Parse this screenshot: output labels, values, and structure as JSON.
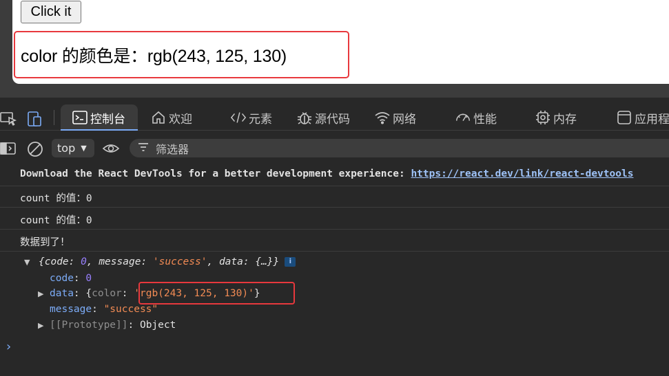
{
  "page": {
    "button_label": "Click it",
    "color_text": "color 的颜色是：rgb(243, 125, 130)"
  },
  "devtools": {
    "tabs": [
      {
        "label": "控制台",
        "icon": "console-icon",
        "active": true
      },
      {
        "label": "欢迎",
        "icon": "home-icon",
        "active": false
      },
      {
        "label": "元素",
        "icon": "elements-icon",
        "active": false
      },
      {
        "label": "源代码",
        "icon": "bug-icon",
        "active": false
      },
      {
        "label": "网络",
        "icon": "wifi-icon",
        "active": false
      },
      {
        "label": "性能",
        "icon": "gauge-icon",
        "active": false
      },
      {
        "label": "内存",
        "icon": "chip-icon",
        "active": false
      },
      {
        "label": "应用程",
        "icon": "app-icon",
        "active": false
      }
    ],
    "toolbar": {
      "context": "top",
      "filter_placeholder": "筛选器"
    }
  },
  "console": {
    "react_msg": "Download the React DevTools for a better development experience: ",
    "react_link": "https://react.dev/link/react-devtools",
    "logs": [
      "count 的值：0",
      "count 的值：0",
      "数据到了！"
    ],
    "object_summary": {
      "open": "{",
      "code_key": "code",
      "code_val": "0",
      "message_key": "message",
      "message_val": "'success'",
      "data_key": "data",
      "data_val": "{…}",
      "close": "}"
    },
    "props": {
      "code_key": "code",
      "code_val": "0",
      "data_key": "data",
      "data_open": "{",
      "color_key": "color",
      "color_val": "'rgb(243, 125, 130)'",
      "data_close": "}",
      "message_key": "message",
      "message_val": "\"success\"",
      "proto_key": "[[Prototype]]",
      "proto_val": "Object"
    },
    "info_badge": "i",
    "prompt": "›"
  },
  "colors": {
    "highlight_border": "#e8383d",
    "devtools_bg": "#282828",
    "accent_blue": "#7cacf8"
  }
}
